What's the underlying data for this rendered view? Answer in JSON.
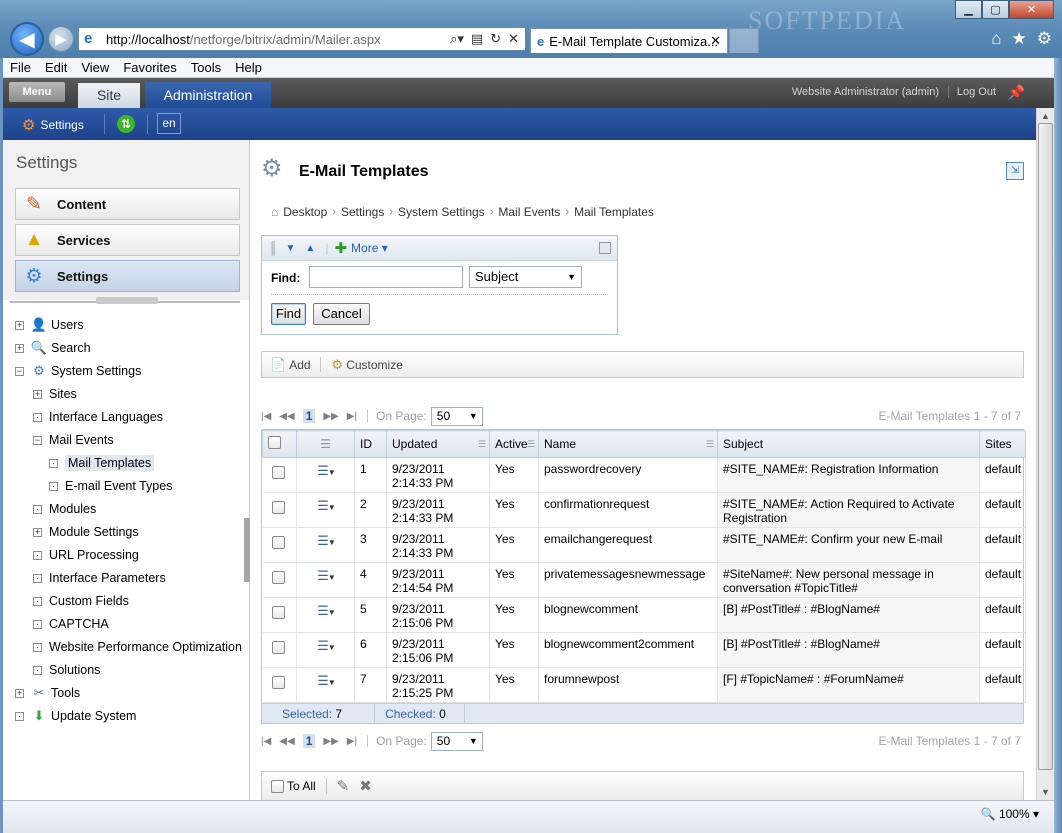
{
  "browser": {
    "address_host": "http://localhost",
    "address_path": "/netforge/bitrix/admin/Mailer.aspx",
    "tab_title": "E-Mail Template Customiza...",
    "watermark": "SOFTPEDIA",
    "menu": [
      "File",
      "Edit",
      "View",
      "Favorites",
      "Tools",
      "Help"
    ],
    "zoom": "100%"
  },
  "admin_top": {
    "menu": "Menu",
    "site": "Site",
    "administration": "Administration",
    "user": "Website Administrator (admin)",
    "logout": "Log Out"
  },
  "admin_blue": {
    "settings": "Settings",
    "lang": "en"
  },
  "sidebar": {
    "title": "Settings",
    "sections": [
      {
        "label": "Content",
        "icon": "content-pencil-icon"
      },
      {
        "label": "Services",
        "icon": "services-shapes-icon"
      },
      {
        "label": "Settings",
        "icon": "settings-gear-icon"
      }
    ],
    "tree": [
      {
        "label": "Users",
        "icon": "users-icon",
        "level": 0,
        "expander": "+"
      },
      {
        "label": "Search",
        "icon": "search-icon",
        "level": 0,
        "expander": "+"
      },
      {
        "label": "System Settings",
        "icon": "gear-icon",
        "level": 0,
        "expander": "−"
      },
      {
        "label": "Sites",
        "level": 1,
        "expander": "+"
      },
      {
        "label": "Interface Languages",
        "level": 1,
        "expander": "·"
      },
      {
        "label": "Mail Events",
        "level": 1,
        "expander": "−"
      },
      {
        "label": "Mail Templates",
        "level": 2,
        "expander": "·",
        "selected": true
      },
      {
        "label": "E-mail Event Types",
        "level": 2,
        "expander": "·"
      },
      {
        "label": "Modules",
        "level": 1,
        "expander": "·"
      },
      {
        "label": "Module Settings",
        "level": 1,
        "expander": "+"
      },
      {
        "label": "URL Processing",
        "level": 1,
        "expander": "·"
      },
      {
        "label": "Interface Parameters",
        "level": 1,
        "expander": "·"
      },
      {
        "label": "Custom Fields",
        "level": 1,
        "expander": "·"
      },
      {
        "label": "CAPTCHA",
        "level": 1,
        "expander": "·"
      },
      {
        "label": "Website Performance Optimization",
        "level": 1,
        "expander": "·"
      },
      {
        "label": "Solutions",
        "level": 1,
        "expander": "·"
      },
      {
        "label": "Tools",
        "icon": "tools-icon",
        "level": 0,
        "expander": "+"
      },
      {
        "label": "Update System",
        "icon": "update-icon",
        "level": 0,
        "expander": "·"
      }
    ]
  },
  "page": {
    "title": "E-Mail Templates",
    "breadcrumb": [
      "Desktop",
      "Settings",
      "System Settings",
      "Mail Events",
      "Mail Templates"
    ]
  },
  "filter": {
    "more": "More",
    "find_label": "Find:",
    "find_value": "",
    "field_select": "Subject",
    "find_button": "Find",
    "cancel_button": "Cancel"
  },
  "toolbar": {
    "add": "Add",
    "customize": "Customize"
  },
  "pager": {
    "current_page": "1",
    "on_page_label": "On Page:",
    "page_size": "50",
    "count_text": "E-Mail Templates 1 - 7 of 7"
  },
  "grid": {
    "columns": [
      "ID",
      "Updated",
      "Active",
      "Name",
      "Subject",
      "Sites"
    ],
    "rows": [
      {
        "id": "1",
        "date": "9/23/2011",
        "time": "2:14:33 PM",
        "active": "Yes",
        "name": "passwordrecovery",
        "subject": "#SITE_NAME#: Registration Information",
        "sites": "default"
      },
      {
        "id": "2",
        "date": "9/23/2011",
        "time": "2:14:33 PM",
        "active": "Yes",
        "name": "confirmationrequest",
        "subject": "#SITE_NAME#: Action Required to Activate Registration",
        "sites": "default"
      },
      {
        "id": "3",
        "date": "9/23/2011",
        "time": "2:14:33 PM",
        "active": "Yes",
        "name": "emailchangerequest",
        "subject": "#SITE_NAME#: Confirm your new E-mail",
        "sites": "default"
      },
      {
        "id": "4",
        "date": "9/23/2011",
        "time": "2:14:54 PM",
        "active": "Yes",
        "name": "privatemessagesnewmessage",
        "subject": "#SiteName#: New personal message in conversation #TopicTitle#",
        "sites": "default"
      },
      {
        "id": "5",
        "date": "9/23/2011",
        "time": "2:15:06 PM",
        "active": "Yes",
        "name": "blognewcomment",
        "subject": "[B] #PostTitle# : #BlogName#",
        "sites": "default"
      },
      {
        "id": "6",
        "date": "9/23/2011",
        "time": "2:15:06 PM",
        "active": "Yes",
        "name": "blognewcomment2comment",
        "subject": "[B] #PostTitle# : #BlogName#",
        "sites": "default"
      },
      {
        "id": "7",
        "date": "9/23/2011",
        "time": "2:15:25 PM",
        "active": "Yes",
        "name": "forumnewpost",
        "subject": "[F] #TopicName# : #ForumName#",
        "sites": "default"
      }
    ],
    "footer": {
      "selected_label": "Selected:",
      "selected": "7",
      "checked_label": "Checked:",
      "checked": "0"
    }
  },
  "bottom": {
    "to_all": "To All"
  }
}
